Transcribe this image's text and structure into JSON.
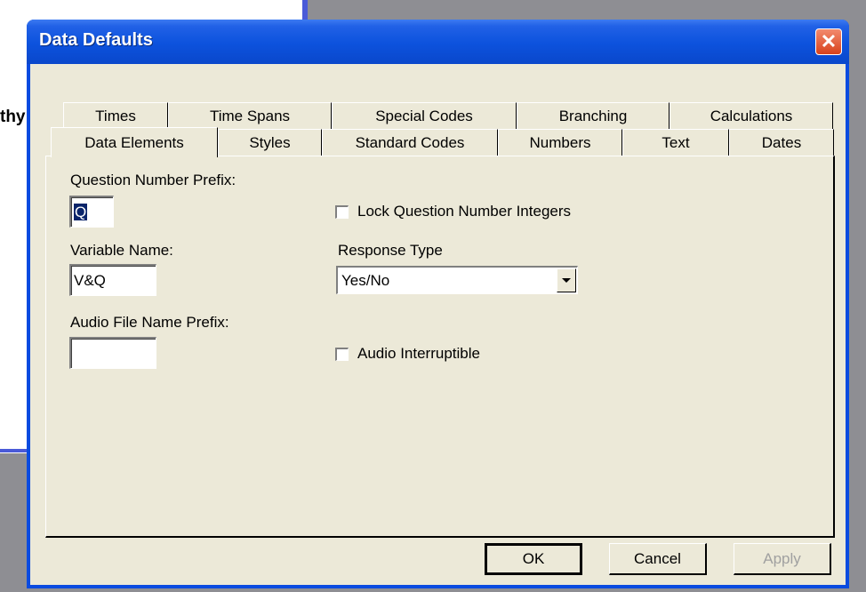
{
  "background": {
    "text_fragment": "thy"
  },
  "window": {
    "title": "Data Defaults",
    "close_glyph": "✕"
  },
  "tabs": {
    "row_back": [
      "Times",
      "Time Spans",
      "Special Codes",
      "Branching",
      "Calculations"
    ],
    "row_front": [
      "Data Elements",
      "Styles",
      "Standard Codes",
      "Numbers",
      "Text",
      "Dates"
    ],
    "active": "Data Elements"
  },
  "form": {
    "question_prefix_label": "Question Number Prefix:",
    "question_prefix_value": "Q",
    "lock_integers_label": "Lock Question Number Integers",
    "lock_integers_checked": false,
    "variable_name_label": "Variable Name:",
    "variable_name_value": "V&Q",
    "response_type_label": "Response Type",
    "response_type_value": "Yes/No",
    "audio_prefix_label": "Audio File Name Prefix:",
    "audio_prefix_value": "",
    "audio_interruptible_label": "Audio Interruptible",
    "audio_interruptible_checked": false
  },
  "buttons": {
    "ok": "OK",
    "cancel": "Cancel",
    "apply": "Apply"
  },
  "colors": {
    "titlebar": "#0a4be0",
    "dialog_face": "#ece9d8",
    "close_button": "#d8421c"
  }
}
